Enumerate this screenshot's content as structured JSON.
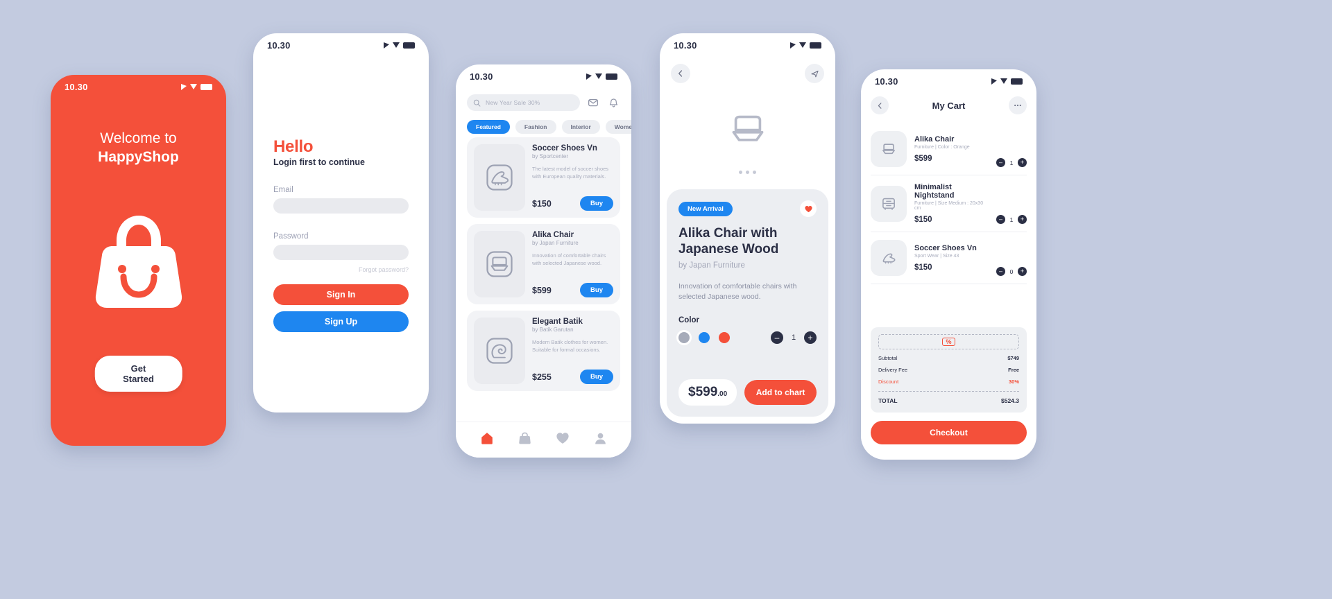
{
  "theme": {
    "accent_red": "#f4503a",
    "accent_blue": "#1e86f0",
    "page_background": "#c3cbe0",
    "ink": "#2b2f45",
    "muted": "#a3a7b8"
  },
  "status_bar": {
    "time": "10.30"
  },
  "welcome": {
    "line1": "Welcome to",
    "line2": "HappyShop",
    "logo_icon": "shopping-bag-smile-icon",
    "cta_label": "Get Started"
  },
  "login": {
    "heading": "Hello",
    "subheading": "Login first to continue",
    "email_label": "Email",
    "email_value": "",
    "email_placeholder": "",
    "password_label": "Password",
    "password_value": "",
    "password_placeholder": "",
    "forgot_label": "Forgot password?",
    "sign_in_label": "Sign In",
    "sign_up_label": "Sign Up"
  },
  "catalog": {
    "search_placeholder": "New Year Sale 30%",
    "search_value": "",
    "search_icon": "search-icon",
    "mail_icon": "mail-icon",
    "bell_icon": "bell-icon",
    "chips": [
      {
        "label": "Featured",
        "active": true
      },
      {
        "label": "Fashion",
        "active": false
      },
      {
        "label": "Interior",
        "active": false
      },
      {
        "label": "Women",
        "active": false
      }
    ],
    "products": [
      {
        "name": "Soccer Shoes Vn",
        "by": "by Sportcenter",
        "description": "The latest model of soccer shoes with European quality materials.",
        "price": "$150",
        "buy_label": "Buy",
        "icon": "soccer-shoe-icon"
      },
      {
        "name": "Alika Chair",
        "by": "by Japan Furniture",
        "description": "Innovation of comfortable chairs with selected Japanese wood.",
        "price": "$599",
        "buy_label": "Buy",
        "icon": "chair-icon"
      },
      {
        "name": "Elegant Batik",
        "by": "by Batik Garutan",
        "description": "Modern Batik clothes for women. Suitable for formal occasions.",
        "price": "$255",
        "buy_label": "Buy",
        "icon": "batik-cloth-icon"
      }
    ],
    "tabs": [
      {
        "icon": "home-icon",
        "active": true
      },
      {
        "icon": "bag-icon",
        "active": false
      },
      {
        "icon": "heart-icon",
        "active": false
      },
      {
        "icon": "person-icon",
        "active": false
      }
    ]
  },
  "detail": {
    "back_icon": "chevron-left-icon",
    "share_icon": "share-icon",
    "hero_icon": "chair-icon",
    "carousel_dots": 3,
    "badge": "New Arrival",
    "favorite_icon": "heart-filled-icon",
    "title": "Alika Chair with Japanese Wood",
    "by": "by Japan Furniture",
    "description": "Innovation of comfortable chairs with selected Japanese wood.",
    "color_label": "Color",
    "colors": [
      {
        "name": "gray",
        "hex": "#a6abb9",
        "selected": true
      },
      {
        "name": "blue",
        "hex": "#1e86f0",
        "selected": false
      },
      {
        "name": "red",
        "hex": "#f4503a",
        "selected": false
      }
    ],
    "quantity": "1",
    "minus_label": "–",
    "plus_label": "+",
    "price_main": "$599",
    "price_cents": ".00",
    "add_to_cart_label": "Add to chart"
  },
  "cart": {
    "back_icon": "chevron-left-icon",
    "title": "My Cart",
    "more_icon": "more-horizontal-icon",
    "items": [
      {
        "name": "Alika Chair",
        "meta": "Furniture | Color : Orange",
        "price": "$599",
        "qty": "1",
        "icon": "chair-icon"
      },
      {
        "name": "Minimalist Nightstand",
        "meta": "Furniture | Size Medium : 20x30 cm",
        "price": "$150",
        "qty": "1",
        "icon": "nightstand-icon"
      },
      {
        "name": "Soccer Shoes Vn",
        "meta": "Sport Wear | Size 43",
        "price": "$150",
        "qty": "0",
        "icon": "soccer-shoe-icon"
      }
    ],
    "coupon_icon": "percent-ticket-icon",
    "coupon_label": "%",
    "summary": [
      {
        "label": "Subtotal",
        "value": "$749",
        "highlight": false
      },
      {
        "label": "Delivery Fee",
        "value": "Free",
        "highlight": false
      },
      {
        "label": "Discount",
        "value": "30%",
        "highlight": true
      }
    ],
    "total_label": "TOTAL",
    "total_value": "$524.3",
    "checkout_label": "Checkout",
    "minus_label": "–",
    "plus_label": "+"
  }
}
